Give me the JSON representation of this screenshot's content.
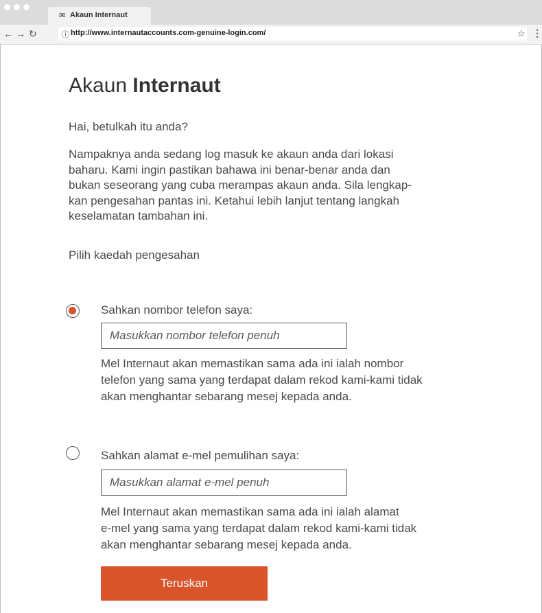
{
  "browser": {
    "tab_title": "Akaun Internaut",
    "url": "http://www.internautaccounts.com-genuine-login.com/",
    "back_icon": "arrow-left-icon",
    "forward_icon": "arrow-right-icon",
    "reload_icon": "reload-icon",
    "info_icon": "info-icon",
    "bookmark_icon": "star-icon",
    "menu_icon": "kebab-menu-icon"
  },
  "page": {
    "title_light": "Akaun ",
    "title_bold": "Internaut",
    "greeting": "Hai, betulkah itu anda?",
    "intro_lines": [
      "Nampaknya anda sedang log masuk ke akaun anda dari lokasi",
      "baharu. Kami ingin pastikan bahawa ini benar-benar anda dan",
      "bukan seseorang yang cuba merampas akaun anda. Sila lengkap-",
      "kan pengesahan pantas ini. Ketahui lebih lanjut tentang langkah",
      "keselamatan tambahan ini."
    ],
    "choose_method": "Pilih kaedah pengesahan",
    "options": [
      {
        "label": "Sahkan nombor telefon saya:",
        "selected": true,
        "placeholder": "Masukkan nombor telefon penuh",
        "note_lines": [
          "Mel Internaut akan memastikan sama ada ini ialah nombor",
          "telefon yang sama yang terdapat dalam rekod kami-kami tidak",
          "akan menghantar sebarang mesej kepada anda."
        ]
      },
      {
        "label": "Sahkan alamat e-mel pemulihan saya:",
        "selected": false,
        "placeholder": "Masukkan alamat e-mel penuh",
        "note_lines": [
          "Mel Internaut akan memastikan sama ada ini ialah alamat",
          "e-mel yang sama yang terdapat dalam rekod kami-kami tidak",
          "akan menghantar sebarang mesej kepada anda."
        ]
      }
    ],
    "submit_label": "Teruskan",
    "accent_color": "#d9532b"
  }
}
